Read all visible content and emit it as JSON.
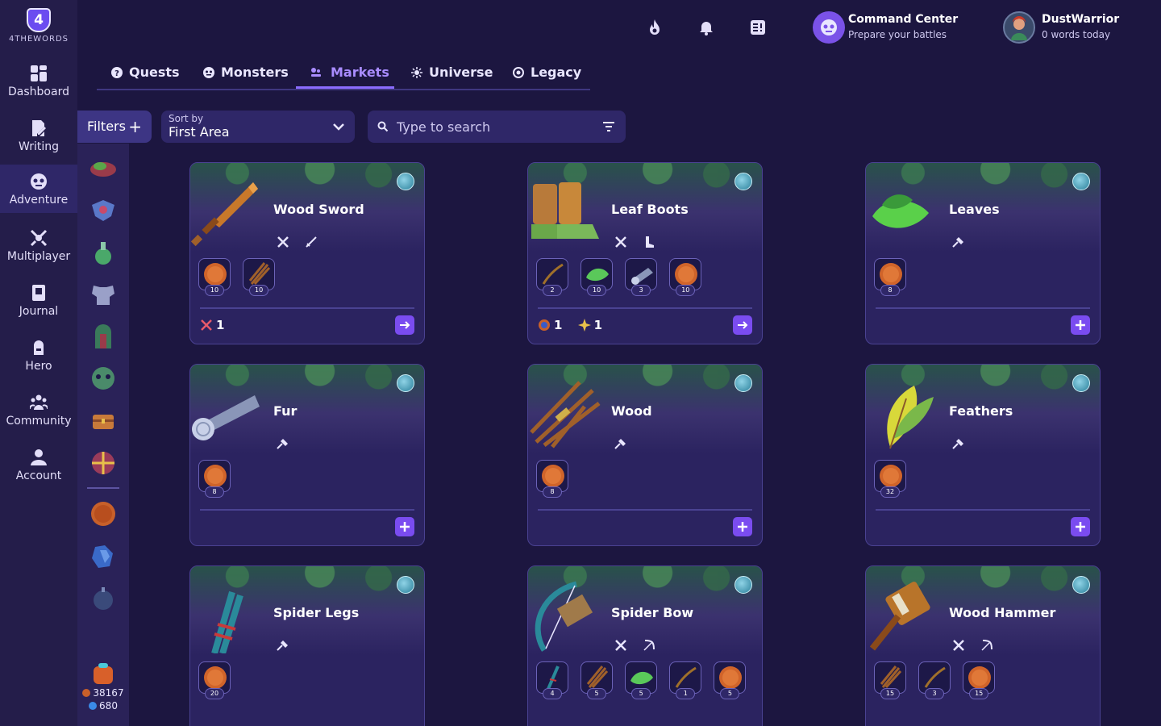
{
  "brand": {
    "badge": "4",
    "name": "4THEWORDS"
  },
  "nav": [
    {
      "label": "Dashboard",
      "icon": "dashboard-icon"
    },
    {
      "label": "Writing",
      "icon": "writing-icon"
    },
    {
      "label": "Adventure",
      "icon": "adventure-icon",
      "active": true
    },
    {
      "label": "Multiplayer",
      "icon": "multiplayer-icon"
    },
    {
      "label": "Journal",
      "icon": "journal-icon"
    },
    {
      "label": "Hero",
      "icon": "hero-icon"
    },
    {
      "label": "Community",
      "icon": "community-icon"
    },
    {
      "label": "Account",
      "icon": "account-icon"
    }
  ],
  "topbar": {
    "command_center": {
      "title": "Command Center",
      "subtitle": "Prepare your battles"
    },
    "user": {
      "name": "DustWarrior",
      "subtitle": "0 words today"
    }
  },
  "tabs": [
    {
      "label": "Quests",
      "icon": "quest-icon"
    },
    {
      "label": "Monsters",
      "icon": "monster-icon"
    },
    {
      "label": "Markets",
      "icon": "market-icon",
      "active": true
    },
    {
      "label": "Universe",
      "icon": "universe-icon"
    },
    {
      "label": "Legacy",
      "icon": "legacy-icon"
    }
  ],
  "toolbar": {
    "filters_label": "Filters",
    "sort_label": "Sort by",
    "sort_value": "First Area",
    "search_placeholder": "Type to search"
  },
  "wallet": {
    "coins": "38167",
    "gems": "680"
  },
  "colors": {
    "accent": "#7a4cf0",
    "background": "#1c1640",
    "card": "#2b2360"
  },
  "cards": [
    {
      "name": "Wood Sword",
      "materials": [
        {
          "icon": "coin-icon",
          "count": "10"
        },
        {
          "icon": "wood-icon",
          "count": "10"
        }
      ],
      "rewards": [
        {
          "icon": "crossed-swords-icon",
          "value": "1"
        }
      ],
      "action": "arrow"
    },
    {
      "name": "Leaf Boots",
      "materials": [
        {
          "icon": "stick-icon",
          "count": "2"
        },
        {
          "icon": "leaf-icon",
          "count": "10"
        },
        {
          "icon": "fur-icon",
          "count": "3"
        },
        {
          "icon": "coin-icon",
          "count": "10"
        }
      ],
      "rewards": [
        {
          "icon": "shield-icon",
          "value": "1"
        },
        {
          "icon": "spark-icon",
          "value": "1"
        }
      ],
      "action": "arrow"
    },
    {
      "name": "Leaves",
      "materials": [
        {
          "icon": "coin-icon",
          "count": "8"
        }
      ],
      "rewards": [],
      "action": "plus"
    },
    {
      "name": "Fur",
      "materials": [
        {
          "icon": "coin-icon",
          "count": "8"
        }
      ],
      "rewards": [],
      "action": "plus"
    },
    {
      "name": "Wood",
      "materials": [
        {
          "icon": "coin-icon",
          "count": "8"
        }
      ],
      "rewards": [],
      "action": "plus"
    },
    {
      "name": "Feathers",
      "materials": [
        {
          "icon": "coin-icon",
          "count": "32"
        }
      ],
      "rewards": [],
      "action": "plus"
    },
    {
      "name": "Spider Legs",
      "materials": [
        {
          "icon": "coin-icon",
          "count": "20"
        }
      ],
      "rewards": [],
      "action": "plus"
    },
    {
      "name": "Spider Bow",
      "materials": [
        {
          "icon": "spider-leg-icon",
          "count": "4"
        },
        {
          "icon": "wood-icon",
          "count": "5"
        },
        {
          "icon": "leaf-icon",
          "count": "5"
        },
        {
          "icon": "stick-icon",
          "count": "1"
        },
        {
          "icon": "coin-icon",
          "count": "5"
        }
      ],
      "rewards": [],
      "action": "none"
    },
    {
      "name": "Wood Hammer",
      "materials": [
        {
          "icon": "wood-icon",
          "count": "15"
        },
        {
          "icon": "stick-icon",
          "count": "3"
        },
        {
          "icon": "coin-icon",
          "count": "15"
        }
      ],
      "rewards": [],
      "action": "none"
    }
  ]
}
